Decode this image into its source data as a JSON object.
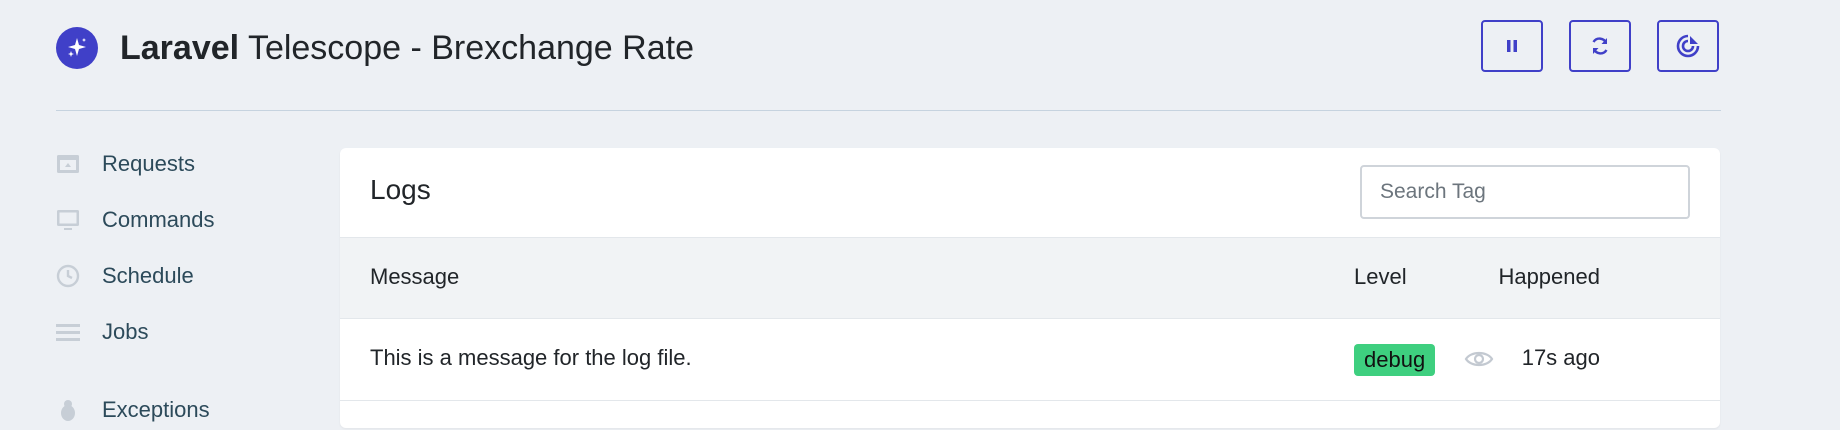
{
  "header": {
    "brand": "Laravel",
    "title": "Telescope - Brexchange Rate",
    "buttons": [
      {
        "name": "pause-icon"
      },
      {
        "name": "refresh-icon"
      },
      {
        "name": "prune-icon"
      }
    ]
  },
  "sidebar": {
    "items": [
      {
        "label": "Requests",
        "icon": "requests-icon"
      },
      {
        "label": "Commands",
        "icon": "monitor-icon"
      },
      {
        "label": "Schedule",
        "icon": "clock-icon"
      },
      {
        "label": "Jobs",
        "icon": "list-icon"
      },
      {
        "label": "Exceptions",
        "icon": "bug-icon"
      }
    ]
  },
  "main": {
    "title": "Logs",
    "search": {
      "placeholder": "Search Tag",
      "value": ""
    },
    "columns": [
      "Message",
      "Level",
      "Happened"
    ],
    "rows": [
      {
        "message": "This is a message for the log file.",
        "level": "debug",
        "happened": "17s ago"
      }
    ]
  },
  "colors": {
    "accent": "#4040c8",
    "background": "#edf0f4",
    "debug_badge": "#3ecf7f"
  }
}
